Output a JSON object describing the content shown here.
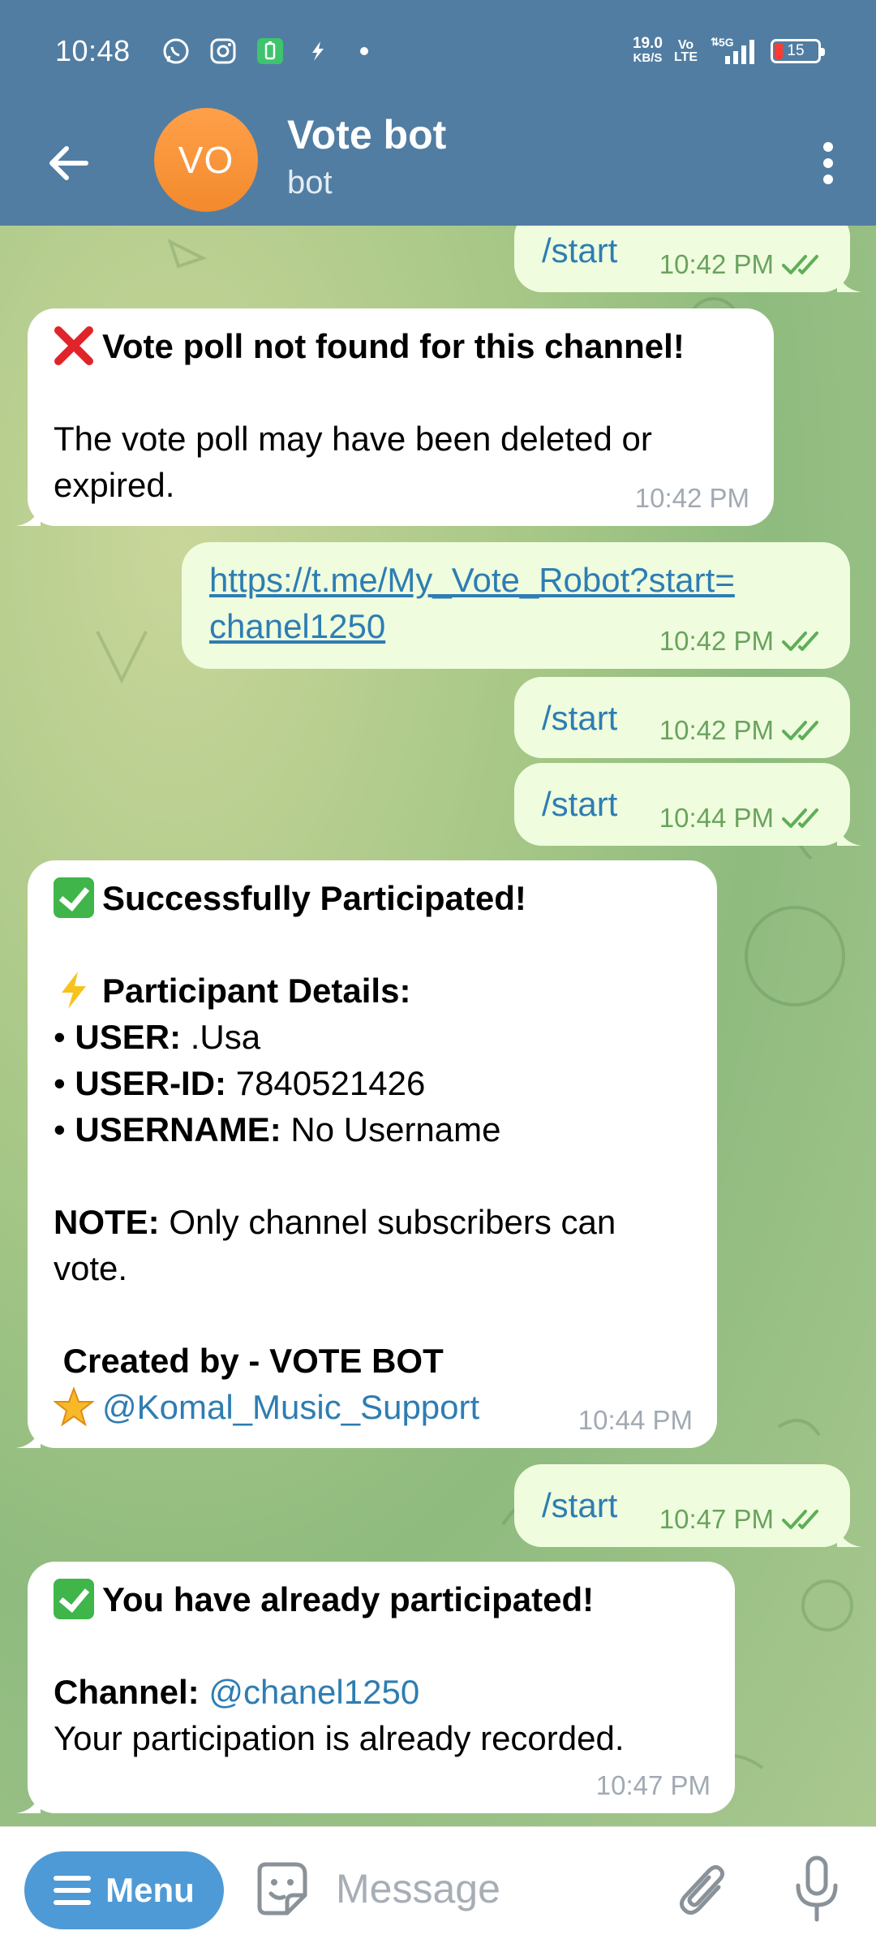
{
  "status_bar": {
    "time": "10:48",
    "net_speed_value": "19.0",
    "net_speed_unit": "KB/S",
    "volte_top": "Vo",
    "volte_bottom": "LTE",
    "network": "5G",
    "battery": "15"
  },
  "header": {
    "avatar_initials": "VO",
    "title": "Vote bot",
    "subtitle": "bot",
    "avatar_color": "#f7923a",
    "bar_color": "#517da2"
  },
  "messages": {
    "m1": {
      "text": "/start",
      "time": "10:42 PM"
    },
    "m2": {
      "title": "Vote poll not found for this channel!",
      "body": "The vote poll may have been deleted or expired.",
      "time": "10:42 PM"
    },
    "m3": {
      "link_line1": "https://t.me/My_Vote_Robot?start=",
      "link_line2": "chanel1250",
      "time": "10:42 PM"
    },
    "m4": {
      "text": "/start",
      "time": "10:42 PM"
    },
    "m5": {
      "text": "/start",
      "time": "10:44 PM"
    },
    "m6": {
      "title": "Successfully Participated!",
      "details_heading": "Participant Details:",
      "user_label": "USER:",
      "user_value": ".Usa",
      "userid_label": "USER-ID:",
      "userid_value": "7840521426",
      "username_label": "USERNAME:",
      "username_value": "No Username",
      "note_label": "NOTE:",
      "note_text": "Only channel subscribers can vote.",
      "created_by": "Created by - VOTE BOT",
      "support_handle": "@Komal_Music_Support",
      "time": "10:44 PM"
    },
    "m7": {
      "text": "/start",
      "time": "10:47 PM"
    },
    "m8": {
      "title": "You have already participated!",
      "channel_label": "Channel:",
      "channel_value": "@chanel1250",
      "body": "Your participation is already recorded.",
      "time": "10:47 PM"
    }
  },
  "input_bar": {
    "menu_label": "Menu",
    "placeholder": "Message"
  },
  "icons": {
    "back": "arrow-left-icon",
    "more": "more-vertical-icon",
    "sticker": "sticker-icon",
    "attach": "paperclip-icon",
    "mic": "microphone-icon",
    "read": "double-check-icon"
  }
}
